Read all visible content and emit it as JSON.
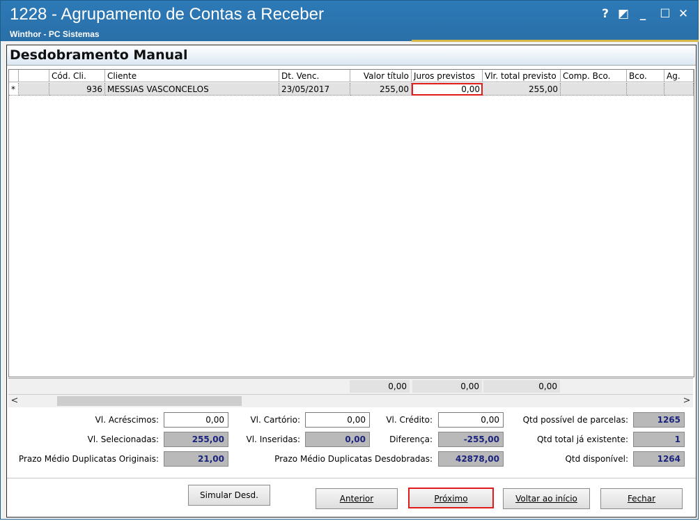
{
  "window": {
    "title": "1228 - Agrupamento de Contas a Receber",
    "subtitle": "Winthor - PC Sistemas",
    "help": "?",
    "restore": "◩",
    "minimize": "_",
    "maximize": "☐",
    "close": "✕"
  },
  "panel": {
    "title": "Desdobramento Manual"
  },
  "grid": {
    "columns": [
      "",
      "Cód. Cli.",
      "Cliente",
      "Dt. Venc.",
      "Valor título",
      "Juros previstos",
      "Vlr. total previsto",
      "Comp. Bco.",
      "Bco.",
      "Ag."
    ],
    "row": {
      "marker": "*",
      "cod_cli": "936",
      "cliente": "MESSIAS VASCONCELOS",
      "dt_venc": "23/05/2017",
      "valor_titulo": "255,00",
      "juros_previstos": "0,00",
      "vlr_total_previsto": "255,00",
      "comp_bco": "",
      "bco": "",
      "ag": ""
    },
    "totals": {
      "valor_titulo": "0,00",
      "juros_previstos": "0,00",
      "vlr_total_previsto": "0,00"
    }
  },
  "scroll": {
    "left": "<",
    "right": ">"
  },
  "form": {
    "vl_acrescimos_label": "Vl. Acréscimos:",
    "vl_acrescimos": "0,00",
    "vl_cartorio_label": "Vl. Cartório:",
    "vl_cartorio": "0,00",
    "vl_credito_label": "Vl. Crédito:",
    "vl_credito": "0,00",
    "qtd_possivel_label": "Qtd possível de parcelas:",
    "qtd_possivel": "1265",
    "vl_selecionadas_label": "Vl. Selecionadas:",
    "vl_selecionadas": "255,00",
    "vl_inseridas_label": "Vl. Inseridas:",
    "vl_inseridas": "0,00",
    "diferenca_label": "Diferença:",
    "diferenca": "-255,00",
    "qtd_total_label": "Qtd total já existente:",
    "qtd_total": "1",
    "prazo_orig_label": "Prazo Médio Duplicatas Originais:",
    "prazo_orig": "21,00",
    "prazo_desd_label": "Prazo Médio Duplicatas Desdobradas:",
    "prazo_desd": "42878,00",
    "qtd_disponivel_label": "Qtd disponível:",
    "qtd_disponivel": "1264"
  },
  "buttons": {
    "simular": "Simular Desd.",
    "anterior": "Anterior",
    "proximo": "Próximo",
    "voltar": "Voltar ao início",
    "fechar": "Fechar"
  },
  "colors": {
    "titlebar": "#2c7ab7",
    "highlight": "#e01b1b",
    "readonly_text": "#1a237e"
  }
}
